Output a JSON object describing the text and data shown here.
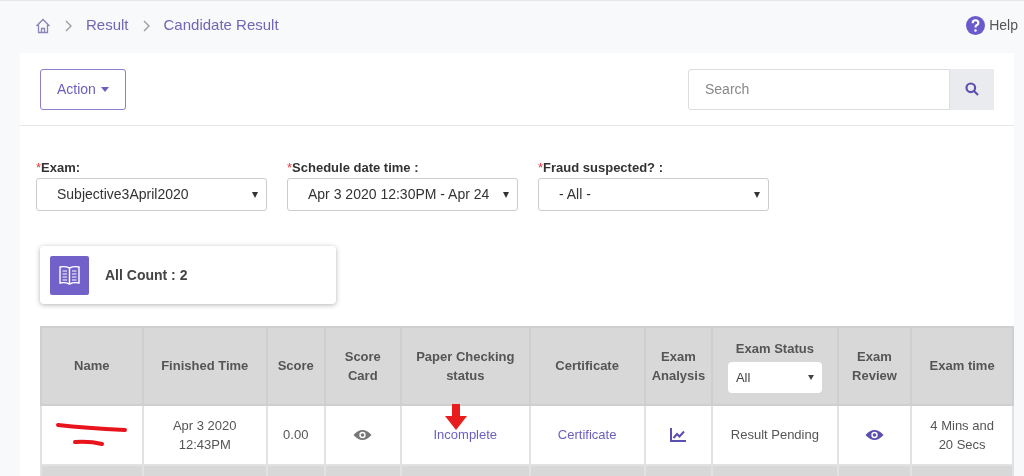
{
  "breadcrumbs": [
    {
      "label": "Result"
    },
    {
      "label": "Candidate Result"
    }
  ],
  "help": {
    "label": "Help"
  },
  "action_button": {
    "label": "Action"
  },
  "search": {
    "placeholder": "Search"
  },
  "filters": [
    {
      "required_mark": "*",
      "label": "Exam:",
      "value": "Subjective3April2020"
    },
    {
      "required_mark": "*",
      "label": "Schedule date time :",
      "value": "Apr 3 2020 12:30PM - Apr 24"
    },
    {
      "required_mark": "*",
      "label": "Fraud suspected? :",
      "value": "- All -"
    }
  ],
  "count_card": {
    "label": "All Count : 2"
  },
  "table": {
    "columns": [
      {
        "label": "Name"
      },
      {
        "label": "Finished Time"
      },
      {
        "label": "Score"
      },
      {
        "label": "Score Card"
      },
      {
        "label": "Paper Checking status"
      },
      {
        "label": "Certificate"
      },
      {
        "label": "Exam Analysis"
      },
      {
        "label": "Exam Status",
        "filter": "All"
      },
      {
        "label": "Exam Review"
      },
      {
        "label": "Exam time"
      }
    ],
    "rows": [
      {
        "name_redacted": true,
        "finished_time": "Apr 3 2020 12:43PM",
        "score": "0.00",
        "paper_checking_status": "Incomplete",
        "certificate": "Certificate",
        "exam_status": "Result Pending",
        "exam_time": "4 Mins and 20 Secs"
      }
    ]
  }
}
